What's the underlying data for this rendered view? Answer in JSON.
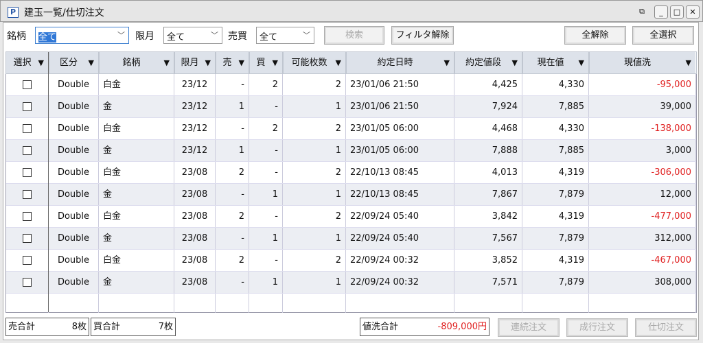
{
  "window": {
    "title": "建玉一覧/仕切注文",
    "icon": "P"
  },
  "filters": {
    "meigara_label": "銘柄",
    "meigara_value": "全て",
    "gengetsu_label": "限月",
    "gengetsu_value": "全て",
    "baibai_label": "売買",
    "baibai_value": "全て"
  },
  "buttons": {
    "search": "検索",
    "clear_filter": "フィルタ解除",
    "deselect_all": "全解除",
    "select_all": "全選択",
    "renzoku": "連続注文",
    "nariyuki": "成行注文",
    "shikiri": "仕切注文"
  },
  "columns": [
    "選択",
    "区分",
    "銘柄",
    "限月",
    "売",
    "買",
    "可能枚数",
    "約定日時",
    "約定値段",
    "現在値",
    "現値洗"
  ],
  "rows": [
    {
      "kubun": "Double",
      "meigara": "白金",
      "gengetsu": "23/12",
      "sell": "-",
      "buy": "2",
      "qty": "2",
      "datetime": "23/01/06 21:50",
      "price": "4,425",
      "current": "4,330",
      "pl": "-95,000",
      "neg": true
    },
    {
      "kubun": "Double",
      "meigara": "金",
      "gengetsu": "23/12",
      "sell": "1",
      "buy": "-",
      "qty": "1",
      "datetime": "23/01/06 21:50",
      "price": "7,924",
      "current": "7,885",
      "pl": "39,000",
      "neg": false
    },
    {
      "kubun": "Double",
      "meigara": "白金",
      "gengetsu": "23/12",
      "sell": "-",
      "buy": "2",
      "qty": "2",
      "datetime": "23/01/05 06:00",
      "price": "4,468",
      "current": "4,330",
      "pl": "-138,000",
      "neg": true
    },
    {
      "kubun": "Double",
      "meigara": "金",
      "gengetsu": "23/12",
      "sell": "1",
      "buy": "-",
      "qty": "1",
      "datetime": "23/01/05 06:00",
      "price": "7,888",
      "current": "7,885",
      "pl": "3,000",
      "neg": false
    },
    {
      "kubun": "Double",
      "meigara": "白金",
      "gengetsu": "23/08",
      "sell": "2",
      "buy": "-",
      "qty": "2",
      "datetime": "22/10/13 08:45",
      "price": "4,013",
      "current": "4,319",
      "pl": "-306,000",
      "neg": true
    },
    {
      "kubun": "Double",
      "meigara": "金",
      "gengetsu": "23/08",
      "sell": "-",
      "buy": "1",
      "qty": "1",
      "datetime": "22/10/13 08:45",
      "price": "7,867",
      "current": "7,879",
      "pl": "12,000",
      "neg": false
    },
    {
      "kubun": "Double",
      "meigara": "白金",
      "gengetsu": "23/08",
      "sell": "2",
      "buy": "-",
      "qty": "2",
      "datetime": "22/09/24 05:40",
      "price": "3,842",
      "current": "4,319",
      "pl": "-477,000",
      "neg": true
    },
    {
      "kubun": "Double",
      "meigara": "金",
      "gengetsu": "23/08",
      "sell": "-",
      "buy": "1",
      "qty": "1",
      "datetime": "22/09/24 05:40",
      "price": "7,567",
      "current": "7,879",
      "pl": "312,000",
      "neg": false
    },
    {
      "kubun": "Double",
      "meigara": "白金",
      "gengetsu": "23/08",
      "sell": "2",
      "buy": "-",
      "qty": "2",
      "datetime": "22/09/24 00:32",
      "price": "3,852",
      "current": "4,319",
      "pl": "-467,000",
      "neg": true
    },
    {
      "kubun": "Double",
      "meigara": "金",
      "gengetsu": "23/08",
      "sell": "-",
      "buy": "1",
      "qty": "1",
      "datetime": "22/09/24 00:32",
      "price": "7,571",
      "current": "7,879",
      "pl": "308,000",
      "neg": false
    }
  ],
  "summary": {
    "sell_label": "売合計",
    "sell_value": "8枚",
    "buy_label": "買合計",
    "buy_value": "7枚",
    "pl_label": "値洗合計",
    "pl_value": "-809,000円"
  },
  "colors": {
    "negative": "#e02020",
    "selection": "#3078d7"
  }
}
